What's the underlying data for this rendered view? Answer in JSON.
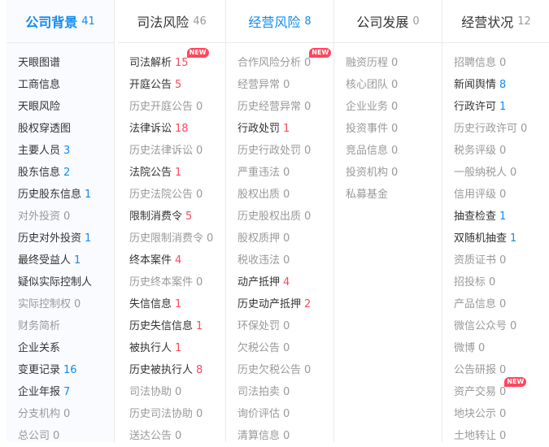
{
  "accent_color": "#128bed",
  "count_red": "#fd485e",
  "muted_color": "#999999",
  "badge_label": "NEW",
  "columns": [
    {
      "title": "公司背景",
      "count": "41",
      "state": "active",
      "items": [
        {
          "label": "天眼图谱",
          "count": "",
          "on": true,
          "color": ""
        },
        {
          "label": "工商信息",
          "count": "",
          "on": true,
          "color": ""
        },
        {
          "label": "天眼风险",
          "count": "",
          "on": true,
          "color": ""
        },
        {
          "label": "股权穿透图",
          "count": "",
          "on": true,
          "color": ""
        },
        {
          "label": "主要人员",
          "count": "3",
          "on": true,
          "color": "blue"
        },
        {
          "label": "股东信息",
          "count": "2",
          "on": true,
          "color": "blue"
        },
        {
          "label": "历史股东信息",
          "count": "1",
          "on": true,
          "color": "blue"
        },
        {
          "label": "对外投资",
          "count": "0",
          "on": false,
          "color": "gray"
        },
        {
          "label": "历史对外投资",
          "count": "1",
          "on": true,
          "color": "blue"
        },
        {
          "label": "最终受益人",
          "count": "1",
          "on": true,
          "color": "blue"
        },
        {
          "label": "疑似实际控制人",
          "count": "",
          "on": true,
          "color": ""
        },
        {
          "label": "实际控制权",
          "count": "0",
          "on": false,
          "color": "gray"
        },
        {
          "label": "财务简析",
          "count": "",
          "on": false,
          "color": ""
        },
        {
          "label": "企业关系",
          "count": "",
          "on": true,
          "color": ""
        },
        {
          "label": "变更记录",
          "count": "16",
          "on": true,
          "color": "blue"
        },
        {
          "label": "企业年报",
          "count": "7",
          "on": true,
          "color": "blue"
        },
        {
          "label": "分支机构",
          "count": "0",
          "on": false,
          "color": "gray"
        },
        {
          "label": "总公司",
          "count": "0",
          "on": false,
          "color": "gray"
        }
      ]
    },
    {
      "title": "司法风险",
      "count": "46",
      "state": "normal",
      "items": [
        {
          "label": "司法解析",
          "count": "15",
          "on": true,
          "color": "red",
          "badge": true
        },
        {
          "label": "开庭公告",
          "count": "5",
          "on": true,
          "color": "red"
        },
        {
          "label": "历史开庭公告",
          "count": "0",
          "on": false,
          "color": "gray"
        },
        {
          "label": "法律诉讼",
          "count": "18",
          "on": true,
          "color": "red"
        },
        {
          "label": "历史法律诉讼",
          "count": "0",
          "on": false,
          "color": "gray"
        },
        {
          "label": "法院公告",
          "count": "1",
          "on": true,
          "color": "red"
        },
        {
          "label": "历史法院公告",
          "count": "0",
          "on": false,
          "color": "gray"
        },
        {
          "label": "限制消费令",
          "count": "5",
          "on": true,
          "color": "red"
        },
        {
          "label": "历史限制消费令",
          "count": "0",
          "on": false,
          "color": "gray"
        },
        {
          "label": "终本案件",
          "count": "4",
          "on": true,
          "color": "red"
        },
        {
          "label": "历史终本案件",
          "count": "0",
          "on": false,
          "color": "gray"
        },
        {
          "label": "失信信息",
          "count": "1",
          "on": true,
          "color": "red"
        },
        {
          "label": "历史失信信息",
          "count": "1",
          "on": true,
          "color": "red"
        },
        {
          "label": "被执行人",
          "count": "1",
          "on": true,
          "color": "red"
        },
        {
          "label": "历史被执行人",
          "count": "8",
          "on": true,
          "color": "red"
        },
        {
          "label": "司法协助",
          "count": "0",
          "on": false,
          "color": "gray"
        },
        {
          "label": "历史司法协助",
          "count": "0",
          "on": false,
          "color": "gray"
        },
        {
          "label": "送达公告",
          "count": "0",
          "on": false,
          "color": "gray"
        }
      ]
    },
    {
      "title": "经营风险",
      "count": "8",
      "state": "blue",
      "items": [
        {
          "label": "合作风险分析",
          "count": "0",
          "on": false,
          "color": "gray",
          "badge": true
        },
        {
          "label": "经营异常",
          "count": "0",
          "on": false,
          "color": "gray"
        },
        {
          "label": "历史经营异常",
          "count": "0",
          "on": false,
          "color": "gray"
        },
        {
          "label": "行政处罚",
          "count": "1",
          "on": true,
          "color": "red"
        },
        {
          "label": "历史行政处罚",
          "count": "0",
          "on": false,
          "color": "gray"
        },
        {
          "label": "严重违法",
          "count": "0",
          "on": false,
          "color": "gray"
        },
        {
          "label": "股权出质",
          "count": "0",
          "on": false,
          "color": "gray"
        },
        {
          "label": "历史股权出质",
          "count": "0",
          "on": false,
          "color": "gray"
        },
        {
          "label": "股权质押",
          "count": "0",
          "on": false,
          "color": "gray"
        },
        {
          "label": "税收违法",
          "count": "0",
          "on": false,
          "color": "gray"
        },
        {
          "label": "动产抵押",
          "count": "4",
          "on": true,
          "color": "red"
        },
        {
          "label": "历史动产抵押",
          "count": "2",
          "on": true,
          "color": "red"
        },
        {
          "label": "环保处罚",
          "count": "0",
          "on": false,
          "color": "gray"
        },
        {
          "label": "欠税公告",
          "count": "0",
          "on": false,
          "color": "gray"
        },
        {
          "label": "历史欠税公告",
          "count": "0",
          "on": false,
          "color": "gray"
        },
        {
          "label": "司法拍卖",
          "count": "0",
          "on": false,
          "color": "gray"
        },
        {
          "label": "询价评估",
          "count": "0",
          "on": false,
          "color": "gray"
        },
        {
          "label": "清算信息",
          "count": "0",
          "on": false,
          "color": "gray"
        }
      ]
    },
    {
      "title": "公司发展",
      "count": "0",
      "state": "normal",
      "items": [
        {
          "label": "融资历程",
          "count": "0",
          "on": false,
          "color": "gray"
        },
        {
          "label": "核心团队",
          "count": "0",
          "on": false,
          "color": "gray"
        },
        {
          "label": "企业业务",
          "count": "0",
          "on": false,
          "color": "gray"
        },
        {
          "label": "投资事件",
          "count": "0",
          "on": false,
          "color": "gray"
        },
        {
          "label": "竞品信息",
          "count": "0",
          "on": false,
          "color": "gray"
        },
        {
          "label": "投资机构",
          "count": "0",
          "on": false,
          "color": "gray"
        },
        {
          "label": "私募基金",
          "count": "",
          "on": false,
          "color": ""
        }
      ]
    },
    {
      "title": "经营状况",
      "count": "12",
      "state": "normal",
      "items": [
        {
          "label": "招聘信息",
          "count": "0",
          "on": false,
          "color": "gray"
        },
        {
          "label": "新闻舆情",
          "count": "8",
          "on": true,
          "color": "blue"
        },
        {
          "label": "行政许可",
          "count": "1",
          "on": true,
          "color": "blue"
        },
        {
          "label": "历史行政许可",
          "count": "0",
          "on": false,
          "color": "gray"
        },
        {
          "label": "税务评级",
          "count": "0",
          "on": false,
          "color": "gray"
        },
        {
          "label": "一般纳税人",
          "count": "0",
          "on": false,
          "color": "gray"
        },
        {
          "label": "信用评级",
          "count": "0",
          "on": false,
          "color": "gray"
        },
        {
          "label": "抽查检查",
          "count": "1",
          "on": true,
          "color": "blue"
        },
        {
          "label": "双随机抽查",
          "count": "1",
          "on": true,
          "color": "blue"
        },
        {
          "label": "资质证书",
          "count": "0",
          "on": false,
          "color": "gray"
        },
        {
          "label": "招投标",
          "count": "0",
          "on": false,
          "color": "gray"
        },
        {
          "label": "产品信息",
          "count": "0",
          "on": false,
          "color": "gray"
        },
        {
          "label": "微信公众号",
          "count": "0",
          "on": false,
          "color": "gray"
        },
        {
          "label": "微博",
          "count": "0",
          "on": false,
          "color": "gray"
        },
        {
          "label": "公告研报",
          "count": "0",
          "on": false,
          "color": "gray"
        },
        {
          "label": "资产交易",
          "count": "0",
          "on": false,
          "color": "gray",
          "badge": true
        },
        {
          "label": "地块公示",
          "count": "0",
          "on": false,
          "color": "gray"
        },
        {
          "label": "土地转让",
          "count": "0",
          "on": false,
          "color": "gray"
        }
      ]
    }
  ]
}
